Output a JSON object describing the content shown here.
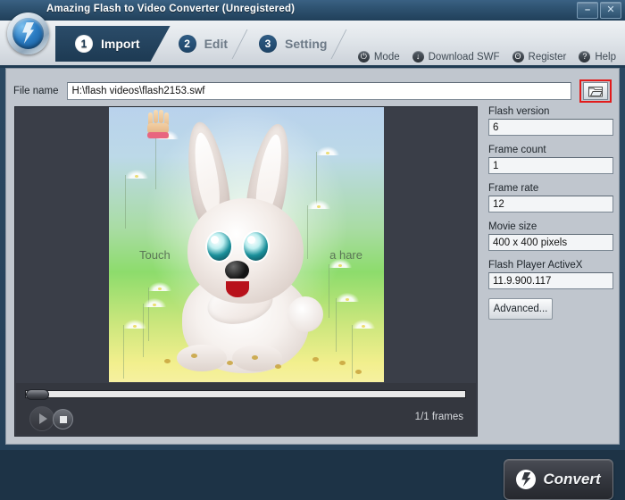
{
  "window": {
    "title": "Amazing Flash to Video Converter (Unregistered)",
    "minimize_label": "–",
    "close_label": "✕",
    "logo_icon": "app-logo-icon"
  },
  "tabs": [
    {
      "number": "1",
      "label": "Import",
      "active": true
    },
    {
      "number": "2",
      "label": "Edit",
      "active": false
    },
    {
      "number": "3",
      "label": "Setting",
      "active": false
    }
  ],
  "topmenu": [
    {
      "label": "Mode",
      "icon": "mode-icon",
      "glyph": "⏻"
    },
    {
      "label": "Download SWF",
      "icon": "download-icon",
      "glyph": "↓"
    },
    {
      "label": "Register",
      "icon": "register-icon",
      "glyph": "ʘ"
    },
    {
      "label": "Help",
      "icon": "help-icon",
      "glyph": "?"
    }
  ],
  "file": {
    "label": "File name",
    "value": "H:\\flash videos\\flash2153.swf",
    "placeholder": "",
    "browse_icon": "folder-open-icon",
    "browse_highlight_color": "#e21b1b"
  },
  "preview": {
    "stage_text_left": "Touch",
    "stage_text_right": "a hare",
    "frames_label": "1/1 frames",
    "play_icon": "play-icon",
    "stop_icon": "stop-icon",
    "seek_position_percent": 0
  },
  "info": [
    {
      "label": "Flash version",
      "value": "6"
    },
    {
      "label": "Frame count",
      "value": "1"
    },
    {
      "label": "Frame rate",
      "value": "12"
    },
    {
      "label": "Movie size",
      "value": "400 x 400 pixels"
    },
    {
      "label": "Flash Player ActiveX",
      "value": "11.9.900.117"
    }
  ],
  "buttons": {
    "advanced": "Advanced...",
    "convert": "Convert",
    "convert_icon": "convert-flash-icon"
  },
  "colors": {
    "panel_bg": "#c0c6ce",
    "title_bar": "#2d516f",
    "active_tab": "#1d3a53",
    "preview_bg": "#3a3e48",
    "accent_red": "#e21b1b"
  }
}
